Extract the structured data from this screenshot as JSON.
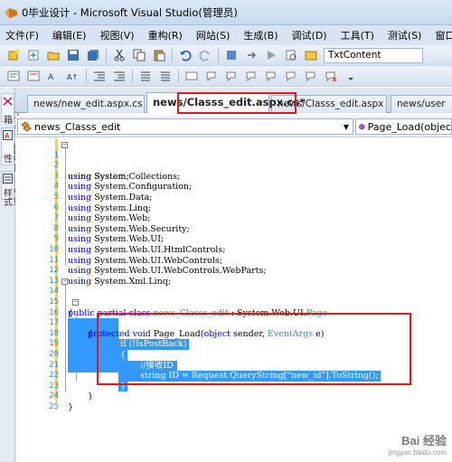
{
  "window": {
    "title": "0毕业设计 - Microsoft Visual Studio(管理员)"
  },
  "menu": [
    "文件(F)",
    "编辑(E)",
    "视图(V)",
    "重构(R)",
    "网站(S)",
    "生成(B)",
    "调试(D)",
    "工具(T)",
    "测试(S)",
    "窗口(W)"
  ],
  "toolbar": {
    "find_combo_value": "TxtContent"
  },
  "sidebar": {
    "tabs": [
      "工具箱",
      "CSS 属性",
      "管理样式"
    ]
  },
  "tabs": [
    {
      "label": "news/new_edit.aspx.cs"
    },
    {
      "label": "news/Classs_edit.aspx.cs*",
      "active": true
    },
    {
      "label": "news/Classs_edit.aspx"
    },
    {
      "label": "news/user"
    }
  ],
  "nav": {
    "class_select": "news_Classs_edit",
    "member_select": "Page_Load(objec"
  },
  "code": {
    "line_numbers": [
      "1",
      "2",
      "3",
      "4",
      "5",
      "6",
      "7",
      "8",
      "9",
      "10",
      "11",
      "12",
      "13",
      "14",
      "15",
      "16",
      "17",
      "18",
      "19",
      "20",
      "21",
      "22",
      "23",
      "24",
      "25"
    ],
    "using_kw": "using",
    "usings": [
      "System;",
      "System.Collections;",
      "System.Configuration;",
      "System.Data;",
      "System.Linq;",
      "System.Web;",
      "System.Web.Security;",
      "System.Web.UI;",
      "System.Web.UI.HtmlControls;",
      "System.Web.UI.WebControls;",
      "System.Web.UI.WebControls.WebParts;",
      "System.Xml.Linq;"
    ],
    "class_decl": {
      "kw": "public partial class",
      "name": "news_Classs_edit",
      "colon": " : ",
      "base_ns": "System.Web.UI.",
      "base": "Page"
    },
    "open_brace": "{",
    "method": {
      "kw1": "protected",
      "kw2": "void",
      "name": " Page_Load(",
      "kw3": "object",
      "p1": " sender, ",
      "type2": "EventArgs",
      "p2": " e)"
    },
    "if_line": "if (!IsPostBack)",
    "inner_open": "{",
    "comment": "//接收ID",
    "assign": "string ID = Request.QueryString[\"new_id\"].ToString();",
    "inner_close": "}",
    "method_close": "}",
    "class_close": "}"
  },
  "watermark": {
    "line1": "Bai 经验",
    "line2": "jingyan.baidu.com"
  }
}
